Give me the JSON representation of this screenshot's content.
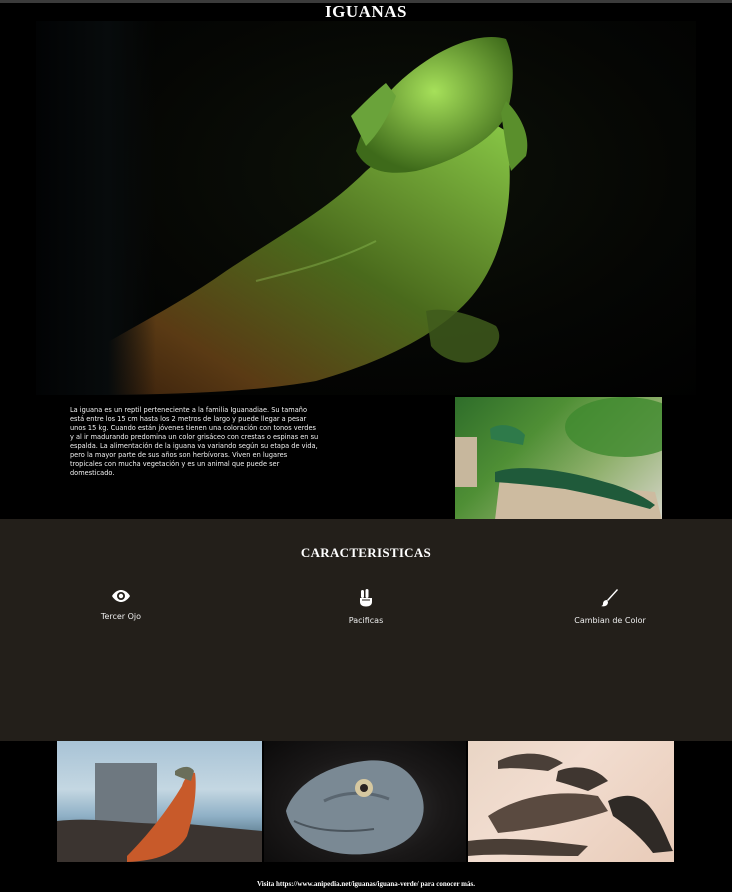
{
  "page": {
    "title": "IGUANAS"
  },
  "intro": {
    "text": "La iguana es un reptil perteneciente a la familia Iguanadiae. Su tamaño está entre los 15 cm hasta los 2 metros de largo y puede llegar a pesar unos 15 kg. Cuando están jóvenes tienen una coloración con tonos verdes y al ir madurando predomina un color grisáceo con crestas o espinas en su espalda. La alimentación de la iguana va variando según su etapa de vida, pero la mayor parte de sus años son herbívoras. Viven en lugares tropicales con mucha vegetación y es un animal que puede ser domesticado."
  },
  "features": {
    "title": "CARACTERISTICAS",
    "items": [
      {
        "label": "Tercer Ojo",
        "icon": "eye-icon"
      },
      {
        "label": "Pacificas",
        "icon": "peace-hand-icon"
      },
      {
        "label": "Cambian de Color",
        "icon": "paint-brush-icon"
      }
    ]
  },
  "footer": {
    "text": "Visita https://www.anipedia.net/iguanas/iguana-verde/ para conocer más."
  },
  "colors": {
    "page_background": "#000000",
    "features_background": "#231f1a",
    "text": "#ffffff"
  }
}
